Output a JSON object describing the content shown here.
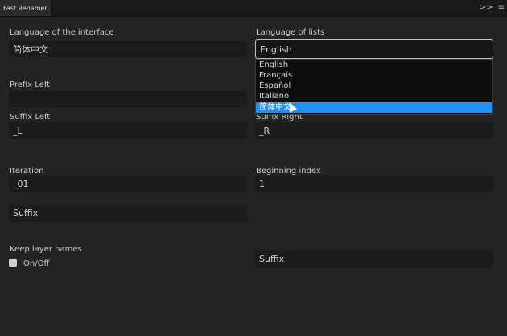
{
  "app": {
    "panel_title": "Fast Renamer"
  },
  "panel_controls": {
    "collapse": ">>",
    "menu": "≡"
  },
  "interface_language": {
    "label": "Language of the interface",
    "value": "简体中文"
  },
  "list_language": {
    "label": "Language of lists",
    "value": "English",
    "options": [
      "English",
      "Français",
      "Español",
      "Italiano",
      "简体中文"
    ],
    "highlighted_index": 4
  },
  "prefix_left": {
    "label": "Prefix Left",
    "value": ""
  },
  "suffix_left": {
    "label": "Suffix Left",
    "value": "_L"
  },
  "suffix_right": {
    "label": "Suffix Right",
    "value": "_R"
  },
  "iteration": {
    "label": "Iteration",
    "value": "_01"
  },
  "beginning_index": {
    "label": "Beginning index",
    "value": "1"
  },
  "iteration_position": {
    "value": "Suffix"
  },
  "keep_layer_names": {
    "label": "Keep layer names",
    "toggle_label": "On/Off",
    "checked": false
  },
  "layer_position": {
    "value": "Suffix"
  }
}
